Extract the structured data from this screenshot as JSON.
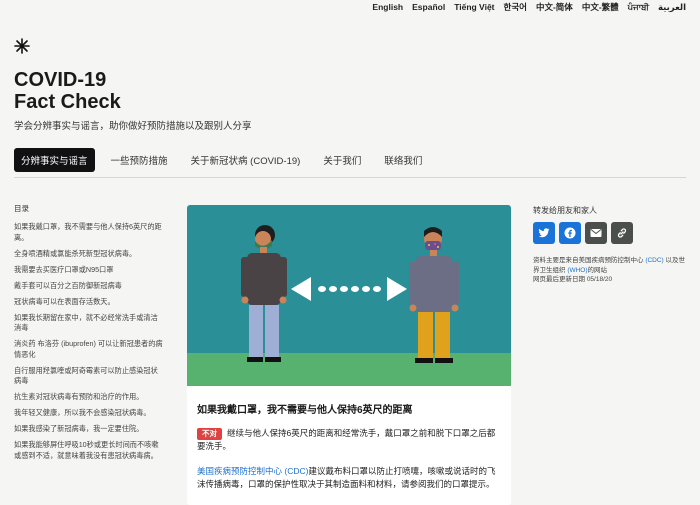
{
  "languages": [
    "English",
    "Español",
    "Tiếng Việt",
    "한국어",
    "中文-简体",
    "中文-繁體",
    "ਪੰਜਾਬੀ",
    "العربية"
  ],
  "logo_icon": "asterisk-burst-icon",
  "header": {
    "title_line1": "COVID-19",
    "title_line2": "Fact Check",
    "subtitle": "学会分辨事实与谣言，助你做好预防措施以及跟别人分享"
  },
  "nav": {
    "tabs": [
      "分辨事实与谣言",
      "一些预防措施",
      "关于新冠状病 (COVID-19)",
      "关于我们",
      "联络我们"
    ],
    "active_index": 0
  },
  "toc": {
    "title": "目录",
    "items": [
      "如果我戴口罩，我不需要与他人保持6英尺的距离。",
      "全身喷酒精或氯能杀死新型冠状病毒。",
      "我需要去买医疗口罩或N95口罩",
      "戴手套可以百分之百防御新冠病毒",
      "冠状病毒可以在表面存活数天。",
      "如果我长期留在家中，就不必经常洗手或清洁消毒",
      "消炎药 布洛芬 (ibuprofen) 可以让新冠患者的病情恶化",
      "自行服用羟氯喹或阿奇霉素可以防止感染冠状病毒",
      "抗生素对冠状病毒有预防和治疗的作用。",
      "我年轻又健康，所以我不会感染冠状病毒。",
      "如果我感染了新冠病毒，我一定要住院。",
      "如果我能够屏住呼吸10秒或更长时间而不咳嗽或感到不适，就意味着我没有患冠状病毒病。"
    ]
  },
  "card": {
    "title": "如果我戴口罩，我不需要与他人保持6英尺的距离",
    "badge": "不对",
    "statement": "继续与他人保持6英尺的距离和经常洗手，戴口罩之前和脱下口罩之后都要洗手。",
    "source_link": "美国疾病预防控制中心 (CDC)",
    "explanation": "建议戴布料口罩以防止打喷嚏，咳嗽或说话时的飞沫传播病毒，口罩的保护性取决于其制造面料和材料，请参阅我们的口罩提示。"
  },
  "share": {
    "title": "转发给朋友和家人",
    "buttons": [
      "twitter-icon",
      "facebook-icon",
      "email-icon",
      "link-icon"
    ],
    "source_prefix": "资料主要是来自美国疾病预防控制中心",
    "source_cdc": "(CDC)",
    "source_mid": "以及世界卫生组织",
    "source_who": "(WHO)",
    "source_suffix": "的网站",
    "updated_label": "网页最后更新日期",
    "updated_date": "05/18/20"
  },
  "colors": {
    "sky": "#2a8f97",
    "ground": "#57b26f",
    "badge": "#e04242",
    "link": "#1d6fd1",
    "share_blue": "#1a73d8",
    "share_dark": "#4a4f4c"
  }
}
